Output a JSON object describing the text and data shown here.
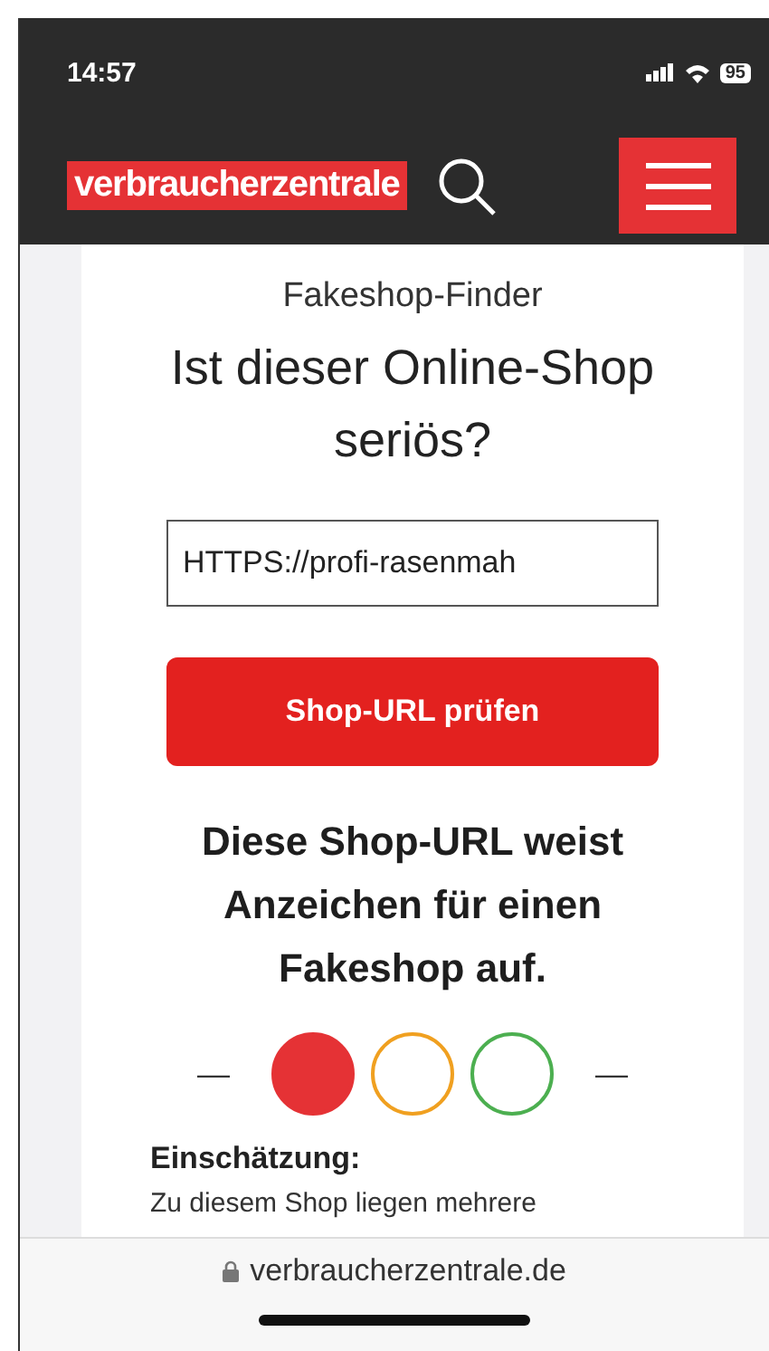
{
  "status_bar": {
    "time": "14:57",
    "battery": "95"
  },
  "header": {
    "logo": "verbraucherzentrale"
  },
  "finder": {
    "kicker": "Fakeshop-Finder",
    "title": "Ist dieser Online-Shop seriös?",
    "url_field": {
      "value": "HTTPS://profi-rasenmah"
    },
    "button": "Shop-URL prüfen"
  },
  "result": {
    "message": "Diese Shop-URL weist Anzeichen für einen Fakeshop auf.",
    "scale_left": "—",
    "scale_right": "—",
    "lights": [
      {
        "color": "#e53235",
        "on": true
      },
      {
        "color": "#f0a020",
        "on": false
      },
      {
        "color": "#4caf50",
        "on": false
      }
    ],
    "assessment_label": "Einschätzung:",
    "assessment_text": "Zu diesem Shop liegen mehrere"
  },
  "browser_bar": {
    "address": "verbraucherzentrale.de"
  }
}
